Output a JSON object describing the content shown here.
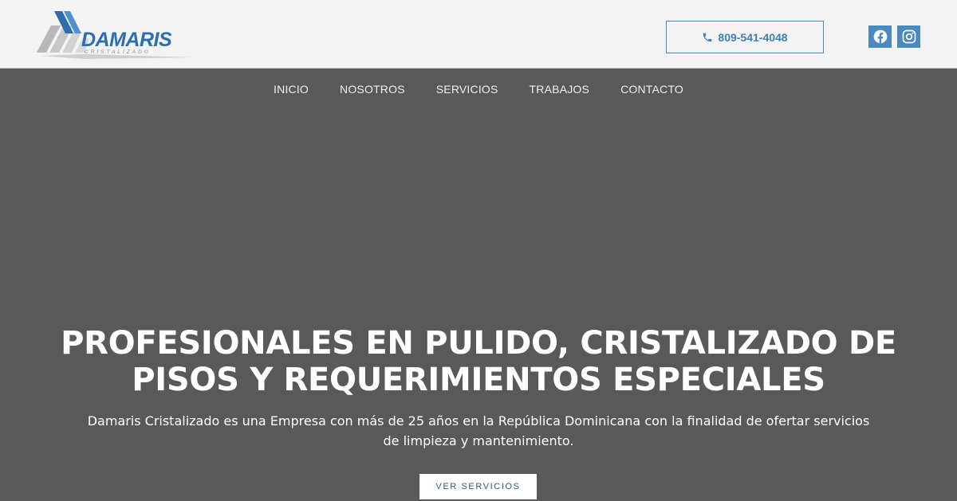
{
  "header": {
    "logo": {
      "brand_text": "DAMARIS",
      "sub_text": "CRISTALIZADO"
    },
    "phone": {
      "label": "809-541-4048",
      "icon": "phone-icon"
    },
    "social": [
      {
        "name": "facebook",
        "icon": "facebook-icon"
      },
      {
        "name": "instagram",
        "icon": "instagram-icon"
      }
    ]
  },
  "nav": {
    "items": [
      {
        "label": "INICIO"
      },
      {
        "label": "NOSOTROS"
      },
      {
        "label": "SERVICIOS"
      },
      {
        "label": "TRABAJOS"
      },
      {
        "label": "CONTACTO"
      }
    ]
  },
  "hero": {
    "title_line1": "PROFESIONALES EN PULIDO, CRISTALIZADO DE",
    "title_line2": "PISOS Y REQUERIMIENTOS ESPECIALES",
    "description_line1": "Damaris Cristalizado es una Empresa con más de 25 años en la República Dominicana con la finalidad de ofertar servicios",
    "description_line2": "de limpieza y mantenimiento.",
    "cta_label": "VER SERVICIOS"
  },
  "colors": {
    "accent": "#3b7fb5",
    "header_bg": "#f3f3f3",
    "hero_bg": "#595959",
    "social_bg": "#4a8ac2",
    "cta_text": "#2e5b7b"
  }
}
